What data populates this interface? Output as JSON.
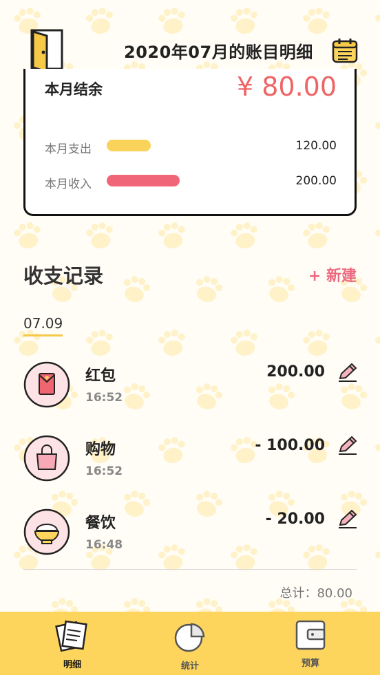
{
  "header": {
    "title": "2020年07月的账目明细"
  },
  "summary": {
    "balance_label": "本月结余",
    "balance_value": "¥ 80.00",
    "expense_label": "本月支出",
    "expense_value": "120.00",
    "expense_ratio": 0.6,
    "income_label": "本月收入",
    "income_value": "200.00",
    "income_ratio": 1.0,
    "expense_color": "#fbd35a",
    "income_color": "#f06578"
  },
  "records": {
    "title": "收支记录",
    "new_label": "+ 新建",
    "date": "07.09",
    "entries": [
      {
        "name": "红包",
        "time": "16:52",
        "amount": "200.00",
        "icon": "red-envelope-icon"
      },
      {
        "name": "购物",
        "time": "16:52",
        "amount": "- 100.00",
        "icon": "shopping-bag-icon"
      },
      {
        "name": "餐饮",
        "time": "16:48",
        "amount": "- 20.00",
        "icon": "rice-bowl-icon"
      }
    ],
    "total": "总计：80.00"
  },
  "tabs": [
    {
      "label": "明细",
      "icon": "document-icon",
      "active": true
    },
    {
      "label": "统计",
      "icon": "pie-chart-icon",
      "active": false
    },
    {
      "label": "预算",
      "icon": "wallet-icon",
      "active": false
    }
  ],
  "colors": {
    "accent": "#fdd55d",
    "balance": "#ee6565",
    "new_button": "#ec6a80"
  }
}
